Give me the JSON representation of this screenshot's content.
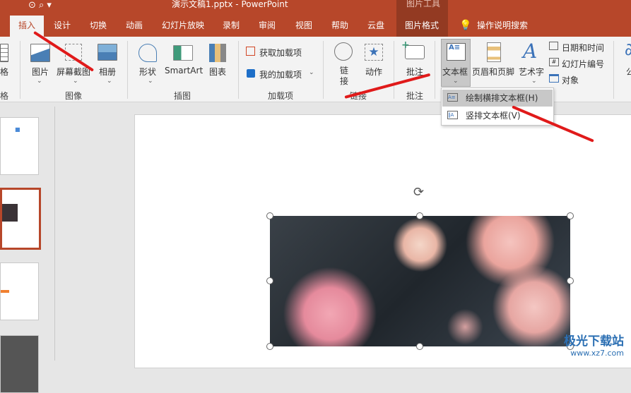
{
  "window": {
    "title": "演示文稿1.pptx  -  PowerPoint",
    "context_tab_group": "图片工具"
  },
  "tabs": [
    {
      "label": "插入",
      "selected": true
    },
    {
      "label": "设计"
    },
    {
      "label": "切换"
    },
    {
      "label": "动画"
    },
    {
      "label": "幻灯片放映"
    },
    {
      "label": "录制"
    },
    {
      "label": "审阅"
    },
    {
      "label": "视图"
    },
    {
      "label": "帮助"
    },
    {
      "label": "云盘"
    },
    {
      "label": "图片格式"
    }
  ],
  "search_label": "操作说明搜索",
  "ribbon": {
    "table": {
      "label": "格",
      "group": "格"
    },
    "images": {
      "group": "图像",
      "picture": "图片",
      "screenshot": "屏幕截图",
      "album": "相册"
    },
    "illustrations": {
      "group": "插图",
      "shapes": "形状",
      "smartart": "SmartArt",
      "chart": "图表"
    },
    "addins": {
      "group": "加载项",
      "get": "获取加载项",
      "mine": "我的加载项"
    },
    "links": {
      "group": "链接",
      "link": "链\n接",
      "action": "动作"
    },
    "comments": {
      "group": "批注",
      "comment": "批注"
    },
    "text": {
      "textbox": "文本框",
      "header_footer": "页眉和页脚",
      "wordart": "艺术字",
      "datetime": "日期和时间",
      "slide_number": "幻灯片编号",
      "object": "对象",
      "more": "公"
    }
  },
  "dropdown": {
    "items": [
      {
        "label": "绘制横排文本框(H)",
        "highlighted": true
      },
      {
        "label": "竖排文本框(V)"
      }
    ]
  },
  "watermark": {
    "brand": "极光下载站",
    "url": "www.xz7.com"
  },
  "colors": {
    "accent": "#b7472a",
    "arrow": "#e01a1a"
  }
}
